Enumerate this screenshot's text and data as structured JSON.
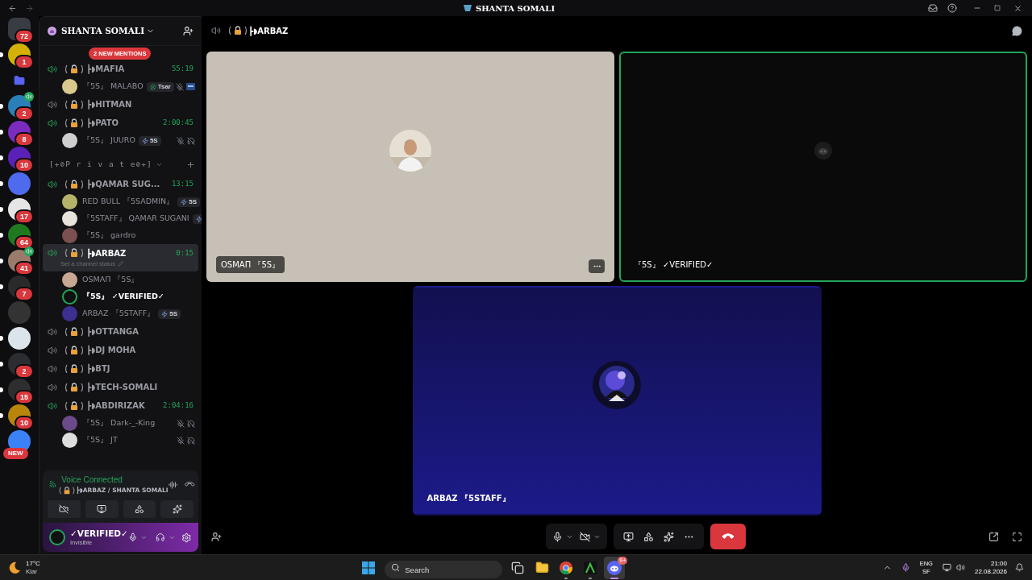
{
  "window": {
    "title": "SHANTA SOMALI"
  },
  "servers": [
    {
      "kind": "dm",
      "badge": "72",
      "color": "#3a3c43",
      "unread": false,
      "voice": false
    },
    {
      "kind": "server",
      "badge": "1",
      "color": "#d4b106",
      "unread": true,
      "voice": false
    },
    {
      "kind": "folder",
      "color": "#5865f2",
      "unread": false,
      "voice": false
    },
    {
      "kind": "server",
      "badge": "2",
      "color": "#2a7fb8",
      "unread": true,
      "voice": true
    },
    {
      "kind": "server",
      "badge": "8",
      "color": "#7b2cbf",
      "unread": true,
      "voice": false
    },
    {
      "kind": "server",
      "badge": "10",
      "color": "#5b21b6",
      "unread": true,
      "voice": false
    },
    {
      "kind": "server",
      "color": "#4f6bed",
      "unread": true,
      "voice": false
    },
    {
      "kind": "server",
      "badge": "17",
      "color": "#e5e5e5",
      "unread": true,
      "voice": false
    },
    {
      "kind": "server",
      "badge": "64",
      "color": "#1f7a1f",
      "unread": true,
      "voice": false
    },
    {
      "kind": "server",
      "badge": "41",
      "color": "#9a7b6b",
      "unread": true,
      "voice": true
    },
    {
      "kind": "server",
      "badge": "7",
      "color": "#2a2a2a",
      "unread": true,
      "voice": false
    },
    {
      "kind": "server",
      "color": "#333333",
      "unread": false,
      "voice": false
    },
    {
      "kind": "server",
      "color": "#dbe4ea",
      "unread": true,
      "voice": false
    },
    {
      "kind": "server",
      "badge": "2",
      "color": "#2b2d31",
      "unread": true,
      "voice": false
    },
    {
      "kind": "server",
      "badge": "15",
      "color": "#2e2e2e",
      "unread": true,
      "voice": false
    },
    {
      "kind": "server",
      "badge": "10",
      "color": "#b8860b",
      "unread": true,
      "voice": false
    },
    {
      "kind": "new",
      "badge": "NEW",
      "color": "#3b82f6",
      "unread": false,
      "voice": false
    }
  ],
  "sidebar": {
    "server_name": "SHANTA SOMALI",
    "mentions": "2 NEW MENTIONS",
    "items": [
      {
        "kind": "channel",
        "name": "┣◗MAFIA",
        "timer": "55:19",
        "active": true,
        "selected": false,
        "users": [
          {
            "name": "『5S』 MALABO",
            "color": "#d9c98f",
            "tag": {
              "kind": "clover",
              "text": "Tsar"
            },
            "muted": true,
            "deafened": false,
            "activity": true,
            "speaking": false,
            "self": false
          }
        ]
      },
      {
        "kind": "channel",
        "name": "┣◗HITMAN",
        "active": false,
        "selected": false
      },
      {
        "kind": "channel",
        "name": "┣◗PATO",
        "timer": "2:00:45",
        "active": true,
        "selected": false,
        "users": [
          {
            "name": "『5S』 JUURO",
            "color": "#cfcfcf",
            "tag": {
              "kind": "bolt",
              "text": "5S"
            },
            "muted": true,
            "deafened": true,
            "activity": false,
            "speaking": false,
            "self": false
          }
        ]
      },
      {
        "kind": "category",
        "name": "[+⊘P r i v a t e⊘+]"
      },
      {
        "kind": "channel",
        "name": "┣◗QAMAR SUG...",
        "timer": "13:15",
        "active": true,
        "selected": false,
        "users": [
          {
            "name": "RED BULL 『5SADMIN』",
            "color": "#b5b36a",
            "tag": {
              "kind": "bolt",
              "text": "5S"
            },
            "muted": false,
            "deafened": false,
            "activity": false,
            "speaking": false,
            "self": false
          },
          {
            "name": "『5STAFF』 QAMAR SUGANI",
            "color": "#e8e2dc",
            "tag": {
              "kind": "bolt"
            },
            "muted": false,
            "deafened": false,
            "activity": false,
            "speaking": false,
            "self": false
          },
          {
            "name": "『5S』 gardro",
            "color": "#7a5050",
            "muted": false,
            "deafened": false,
            "activity": false,
            "speaking": false,
            "self": false
          }
        ]
      },
      {
        "kind": "channel",
        "name": "┣◗ARBAZ",
        "timer": "0:15",
        "status": "Set a channel status",
        "active": true,
        "selected": true,
        "users": [
          {
            "name": "OSMAΠ 『5S』",
            "color": "#c8a892",
            "muted": false,
            "deafened": false,
            "activity": false,
            "speaking": false,
            "self": false
          },
          {
            "name": "『5S』 ✓VERIFIED✓",
            "color": "#101010",
            "muted": false,
            "deafened": false,
            "activity": false,
            "speaking": true,
            "self": true
          },
          {
            "name": "ARBAZ 『5STAFF』",
            "color": "#3b2f8f",
            "tag": {
              "kind": "bolt",
              "text": "5S"
            },
            "muted": false,
            "deafened": false,
            "activity": false,
            "speaking": false,
            "self": false
          }
        ]
      },
      {
        "kind": "channel",
        "name": "┣◗OTTANGA",
        "active": false,
        "selected": false
      },
      {
        "kind": "channel",
        "name": "┣◗DJ MOHA",
        "active": false,
        "selected": false
      },
      {
        "kind": "channel",
        "name": "┣◗BTJ",
        "active": false,
        "selected": false
      },
      {
        "kind": "channel",
        "name": "┣◗TECH-SOMALI",
        "active": false,
        "selected": false
      },
      {
        "kind": "channel",
        "name": "┣◗ABDIRIZAK",
        "timer": "2:04:16",
        "active": true,
        "selected": false,
        "users": [
          {
            "name": "『5S』 Dark-_-King",
            "color": "#6b4a8a",
            "muted": true,
            "deafened": true,
            "activity": false,
            "speaking": false,
            "self": false
          },
          {
            "name": "『5S』 JT",
            "color": "#dddddd",
            "muted": true,
            "deafened": true,
            "activity": false,
            "speaking": false,
            "self": false
          }
        ]
      }
    ]
  },
  "voice_panel": {
    "status": "Voice Connected",
    "location": "┣◗ARBAZ / SHANTA SOMALI"
  },
  "user_panel": {
    "name": "✓VERIFIED✓",
    "status": "Invisible"
  },
  "call": {
    "channel": "┣◗ARBAZ",
    "tiles": [
      {
        "label": "OSMAΠ 『5S』",
        "speaking": false,
        "menu": true
      },
      {
        "kind": "dark",
        "label": "『5S』 ✓VERIFIED✓",
        "speaking": true,
        "menu": false
      },
      {
        "kind": "art",
        "label": "ARBAZ 『5STAFF』",
        "speaking": false,
        "menu": false
      }
    ]
  },
  "taskbar": {
    "weather": {
      "temp": "17°C",
      "text": "Klar"
    },
    "search": {
      "placeholder": "Search"
    },
    "apps": [
      {
        "kind": "taskview",
        "running": false,
        "active": false
      },
      {
        "kind": "explorer",
        "running": false,
        "active": false
      },
      {
        "kind": "chrome",
        "running": true,
        "active": false
      },
      {
        "kind": "app",
        "running": true,
        "active": false
      },
      {
        "kind": "discord",
        "running": true,
        "active": true,
        "badge": "9+"
      }
    ],
    "lang": "ENG",
    "layout": "SF",
    "time": "21:00",
    "date": "22.08.2026"
  }
}
